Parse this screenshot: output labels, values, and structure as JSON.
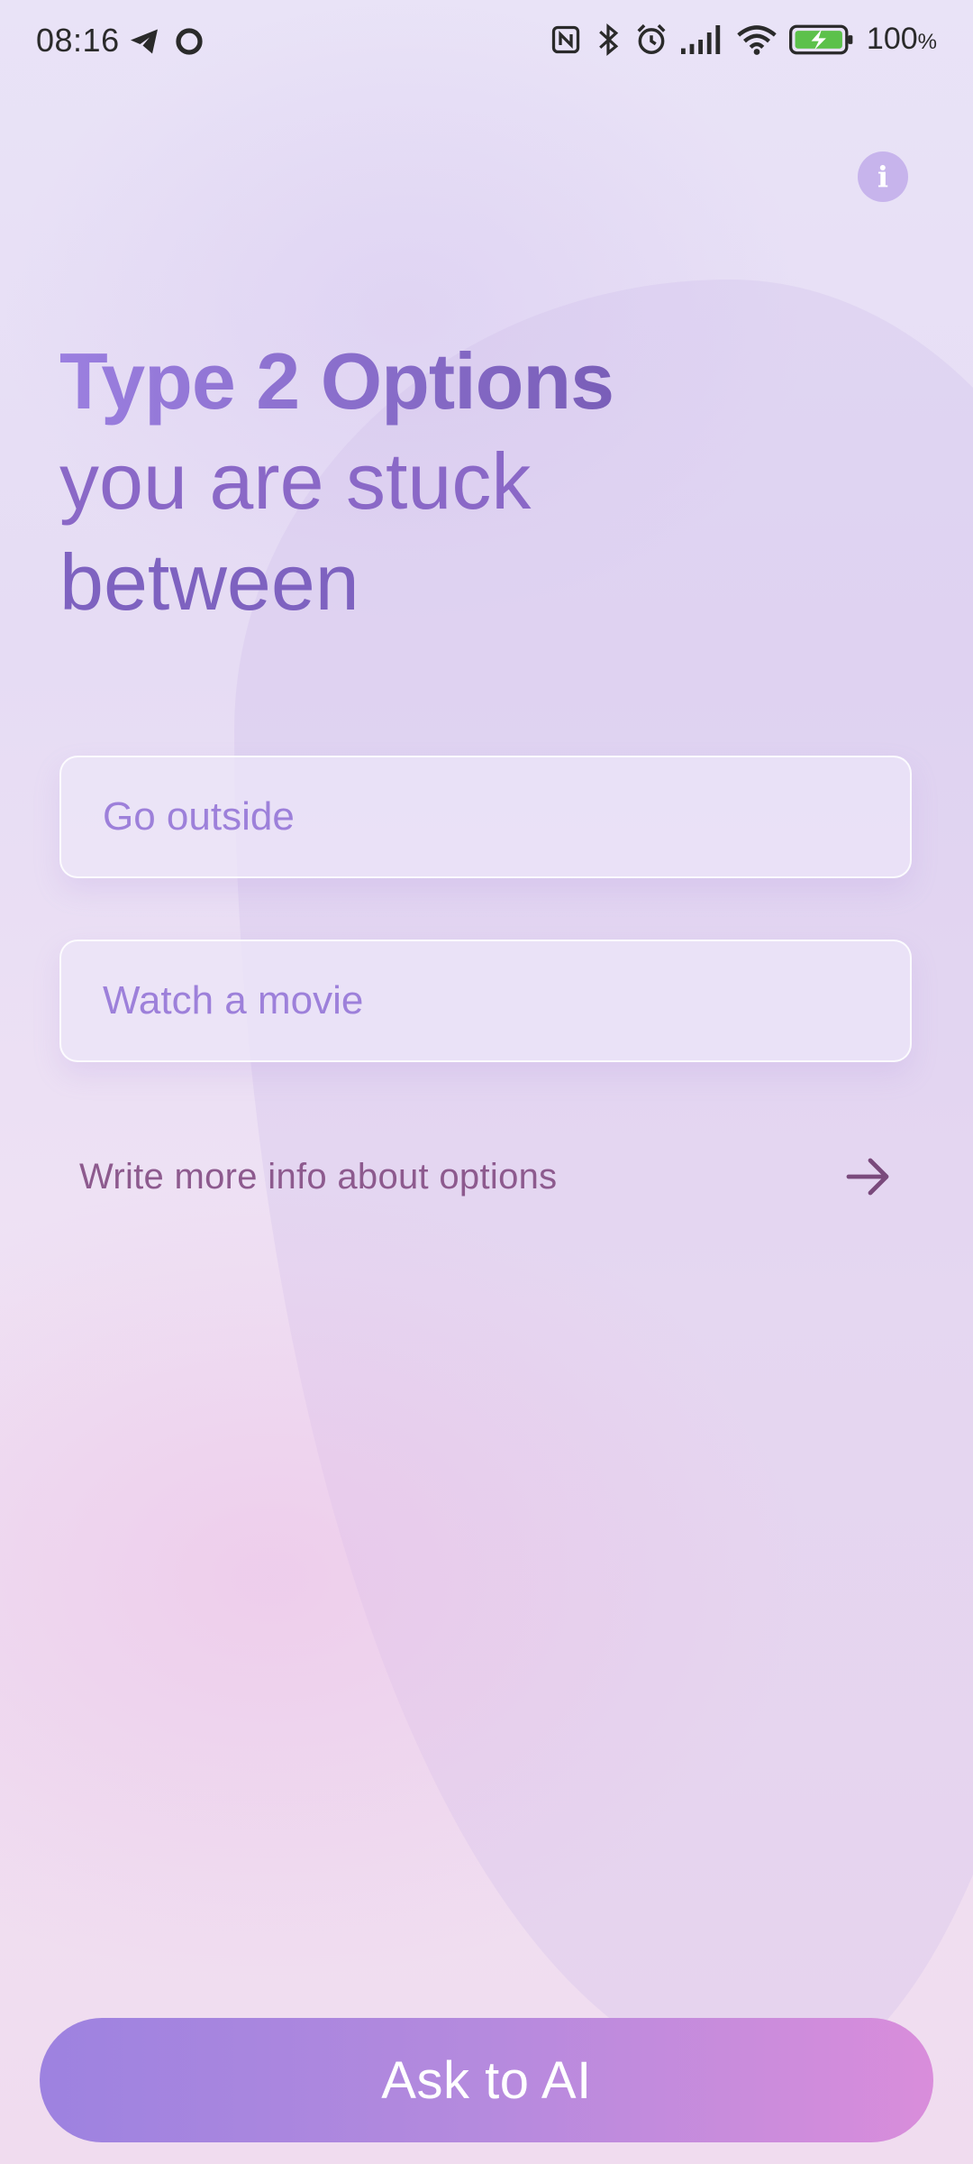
{
  "status_bar": {
    "time": "08:16",
    "battery_percent": "100",
    "battery_unit": "%",
    "icons_left": [
      "telegram-icon",
      "circle-record-icon"
    ],
    "icons_right": [
      "nfc-icon",
      "bluetooth-icon",
      "alarm-icon",
      "signal-icon",
      "wifi-icon",
      "battery-charging-icon"
    ]
  },
  "header": {
    "info_icon": "info-icon",
    "info_glyph": "i"
  },
  "headline": {
    "bold": "Type 2 Options",
    "line2": "you are stuck",
    "line3": "between"
  },
  "options": {
    "option1_value": "",
    "option1_placeholder": "Go outside",
    "option2_value": "",
    "option2_placeholder": "Watch a movie"
  },
  "more_info": {
    "label": "Write more info about options",
    "icon": "arrow-right-icon"
  },
  "action": {
    "ask_label": "Ask to AI"
  },
  "colors": {
    "accent_start": "#9d82e0",
    "accent_end": "#d98ddb",
    "headline": "#7e62c0",
    "more_info_text": "#8d5a8e"
  }
}
